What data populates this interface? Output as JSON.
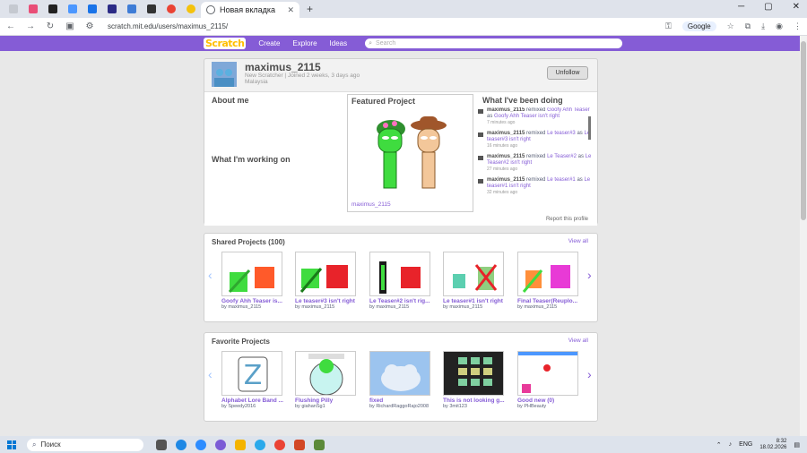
{
  "browser": {
    "active_tab_title": "Новая вкладка",
    "url": "scratch.mit.edu/users/maximus_2115/",
    "google_label": "Google"
  },
  "scratch_nav": {
    "logo": "Scratch",
    "create": "Create",
    "explore": "Explore",
    "ideas": "Ideas",
    "search_placeholder": "Search"
  },
  "profile": {
    "username": "maximus_2115",
    "rank": "New Scratcher",
    "joined": "Joined 2 weeks, 3 days ago",
    "country": "Malaysia",
    "unfollow_label": "Unfollow",
    "about_title": "About me",
    "working_title": "What I'm working on",
    "featured_title": "Featured Project",
    "featured_name": "maximus_2115",
    "activity_title": "What I've been doing",
    "report_label": "Report this profile"
  },
  "activity": [
    {
      "user": "maximus_2115",
      "verb": "remixed",
      "project": "Goofy Ahh Teaser",
      "as_word": "as",
      "new_name": "Goofy Ahh Teaser isn't right",
      "time": "7 minutes ago"
    },
    {
      "user": "maximus_2115",
      "verb": "remixed",
      "project": "Le teaser#3",
      "as_word": "as",
      "new_name": "Le teaser#3 isn't right",
      "time": "16 minutes ago"
    },
    {
      "user": "maximus_2115",
      "verb": "remixed",
      "project": "Le Teaser#2",
      "as_word": "as",
      "new_name": "Le Teaser#2 isn't right",
      "time": "27 minutes ago"
    },
    {
      "user": "maximus_2115",
      "verb": "remixed",
      "project": "Le teaser#1",
      "as_word": "as",
      "new_name": "Le teaser#1 isn't right",
      "time": "32 minutes ago"
    }
  ],
  "shared": {
    "title": "Shared Projects (100)",
    "view_all": "View all",
    "items": [
      {
        "title": "Goofy Ahh Teaser is...",
        "by": "by maximus_2115"
      },
      {
        "title": "Le teaser#3 isn't right",
        "by": "by maximus_2115"
      },
      {
        "title": "Le Teaser#2 isn't rig...",
        "by": "by maximus_2115"
      },
      {
        "title": "Le teaser#1 isn't right",
        "by": "by maximus_2115"
      },
      {
        "title": "Final Teaser(Reuplo...",
        "by": "by maximus_2115"
      }
    ]
  },
  "favorites": {
    "title": "Favorite Projects",
    "view_all": "View all",
    "items": [
      {
        "title": "Alphabet Lore Band ...",
        "by": "by Speedy2016"
      },
      {
        "title": "Flushing Pilly",
        "by": "by giahanSg1"
      },
      {
        "title": "fixed",
        "by": "by RichardRaggoRajo2008"
      },
      {
        "title": "This is not looking g...",
        "by": "by 3mit123"
      },
      {
        "title": "Good new (0)",
        "by": "by PHBeauty"
      }
    ]
  },
  "taskbar": {
    "search_label": "Поиск",
    "lang": "ENG",
    "time": "8:32",
    "date": "18.02.2026"
  },
  "colors": {
    "scratch_purple": "#855cd6",
    "link_purple": "#855cd6",
    "taskbar": "#dde3ec"
  }
}
